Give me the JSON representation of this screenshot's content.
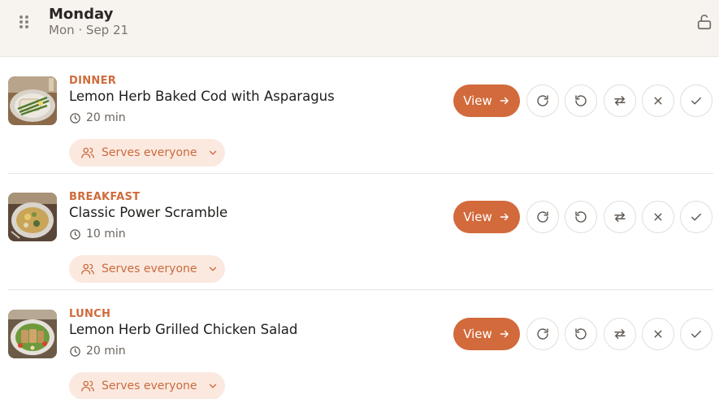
{
  "day": {
    "title": "Monday",
    "date": "Mon · Sep 21"
  },
  "meals": [
    {
      "type": "DINNER",
      "name": "Lemon Herb Baked Cod with Asparagus",
      "time": "20 min",
      "serves": "Serves everyone",
      "view_label": "View"
    },
    {
      "type": "BREAKFAST",
      "name": "Classic Power Scramble",
      "time": "10 min",
      "serves": "Serves everyone",
      "view_label": "View"
    },
    {
      "type": "LUNCH",
      "name": "Lemon Herb Grilled Chicken Salad",
      "time": "20 min",
      "serves": "Serves everyone",
      "view_label": "View"
    }
  ],
  "colors": {
    "accent": "#d26a3c",
    "header_bg": "#f7f3ef",
    "chip_bg": "#fbe9e0"
  },
  "icons": [
    "drag-handle-icon",
    "unlock-icon",
    "clock-icon",
    "users-icon",
    "chevron-down-icon",
    "arrow-right-icon",
    "refresh-icon",
    "regenerate-icon",
    "swap-icon",
    "close-icon",
    "check-icon"
  ]
}
